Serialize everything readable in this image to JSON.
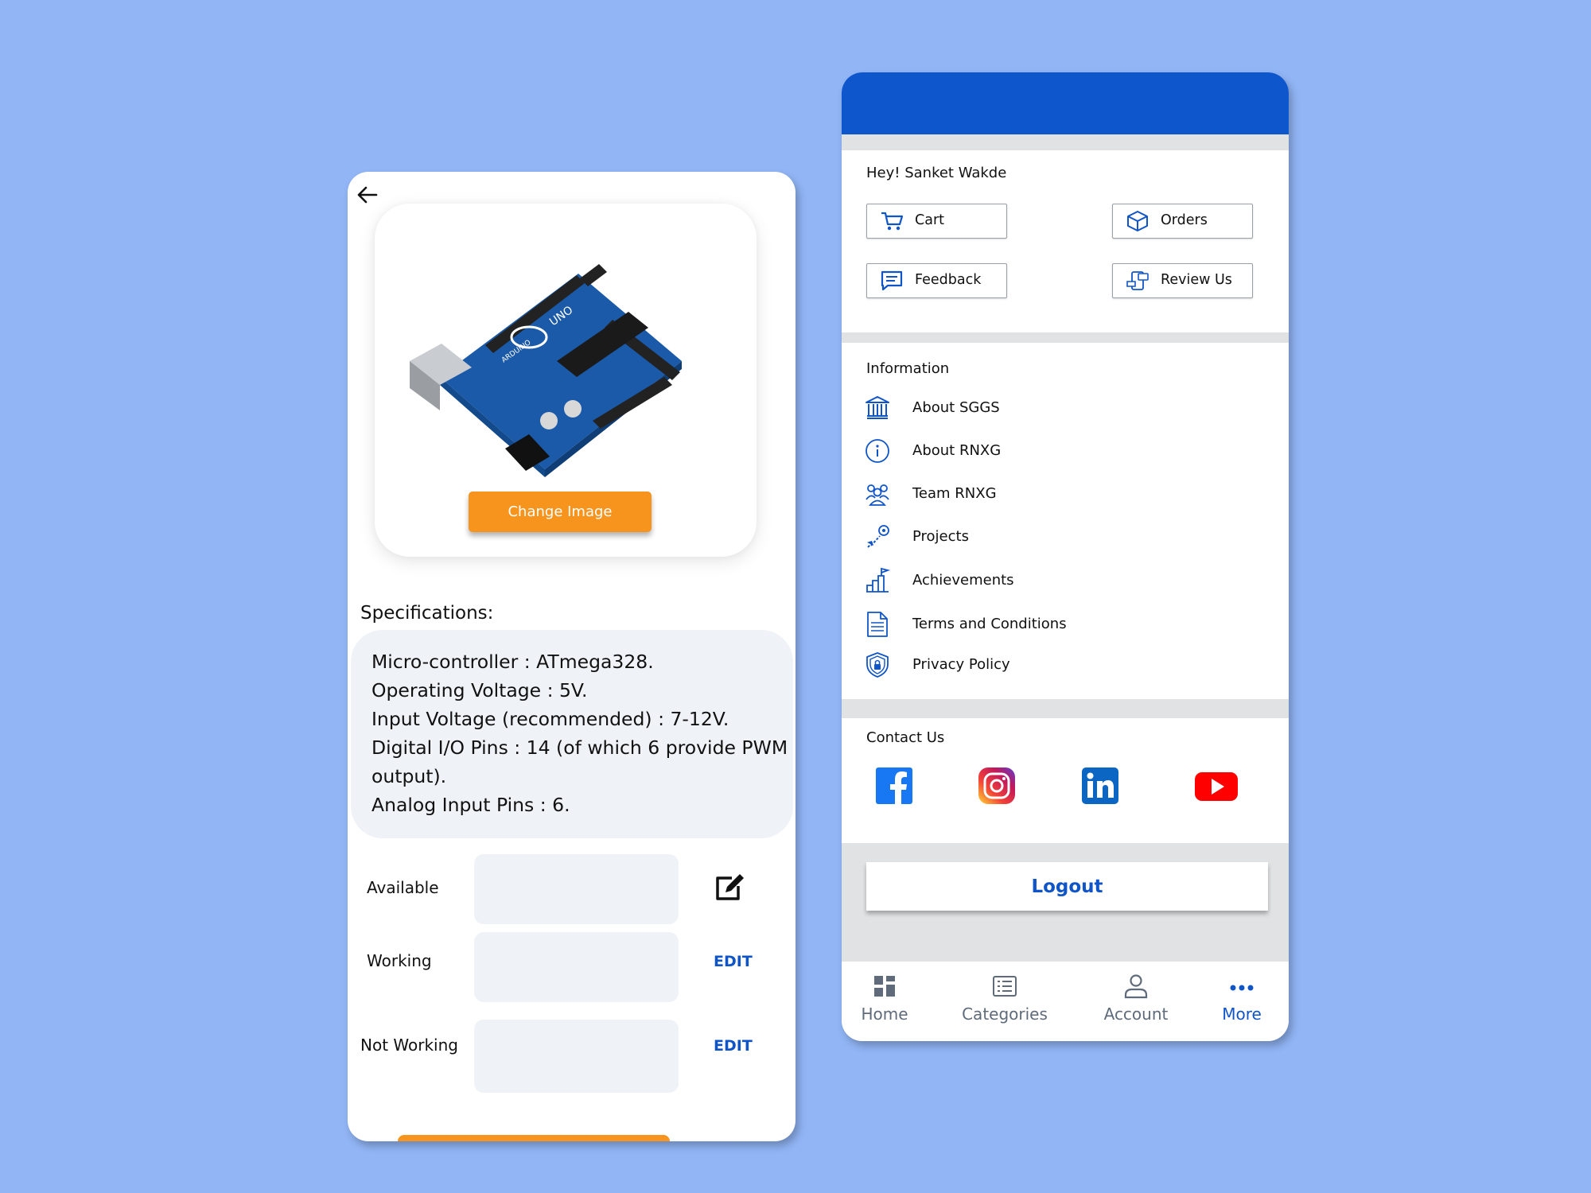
{
  "product_screen": {
    "change_image_label": "Change Image",
    "specifications_title": "Specifications:",
    "specifications": [
      "Micro-controller : ATmega328.",
      "Operating Voltage : 5V.",
      "Input Voltage (recommended) : 7-12V.",
      "Digital I/O Pins : 14 (of which 6 provide PWM output).",
      "Analog Input Pins : 6."
    ],
    "status_rows": [
      {
        "label": "Available",
        "value": "",
        "action": ""
      },
      {
        "label": "Working",
        "value": "",
        "action": "EDIT"
      },
      {
        "label": "Not Working",
        "value": "",
        "action": "EDIT"
      }
    ],
    "board_text": {
      "brand": "ARDUINO",
      "model": "UNO"
    }
  },
  "more_screen": {
    "greeting": "Hey! Sanket Wakde",
    "quick_actions": [
      {
        "label": "Cart",
        "icon": "cart-icon"
      },
      {
        "label": "Orders",
        "icon": "box-icon"
      },
      {
        "label": "Feedback",
        "icon": "chat-icon"
      },
      {
        "label": "Review Us",
        "icon": "review-icon"
      }
    ],
    "information_title": "Information",
    "information_items": [
      {
        "label": "About SGGS",
        "icon": "institution-icon"
      },
      {
        "label": "About RNXG",
        "icon": "info-icon"
      },
      {
        "label": "Team RNXG",
        "icon": "team-icon"
      },
      {
        "label": "Projects",
        "icon": "projects-icon"
      },
      {
        "label": "Achievements",
        "icon": "achievements-icon"
      },
      {
        "label": "Terms and Conditions",
        "icon": "document-icon"
      },
      {
        "label": "Privacy Policy",
        "icon": "shield-icon"
      }
    ],
    "contact_title": "Contact Us",
    "social": [
      "facebook-icon",
      "instagram-icon",
      "linkedin-icon",
      "youtube-icon"
    ],
    "logout_label": "Logout",
    "nav": [
      {
        "label": "Home",
        "icon": "home-icon",
        "active": false
      },
      {
        "label": "Categories",
        "icon": "list-icon",
        "active": false
      },
      {
        "label": "Account",
        "icon": "user-icon",
        "active": false
      },
      {
        "label": "More",
        "icon": "more-icon",
        "active": true
      }
    ]
  },
  "colors": {
    "background": "#91b5f5",
    "primary_blue": "#0e56cc",
    "orange": "#f7941d",
    "field_gray": "#eff2f6"
  }
}
